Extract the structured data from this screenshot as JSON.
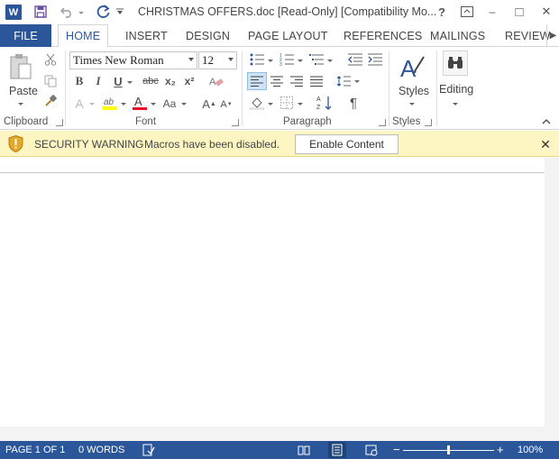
{
  "window": {
    "title": "CHRISTMAS OFFERS.doc [Read-Only] [Compatibility Mo...",
    "logo_letter": "W",
    "help": "?",
    "minimize": "–",
    "restore": "□",
    "close": "✕"
  },
  "tabs": {
    "file": "FILE",
    "items": [
      "HOME",
      "INSERT",
      "DESIGN",
      "PAGE LAYOUT",
      "REFERENCES",
      "MAILINGS",
      "REVIEW"
    ],
    "active": "HOME"
  },
  "ribbon": {
    "clipboard": {
      "label": "Clipboard",
      "paste": "Paste"
    },
    "font": {
      "label": "Font",
      "font_name": "Times New Roman",
      "font_size": "12",
      "bold": "B",
      "italic": "I",
      "underline": "U",
      "strikethrough": "abc",
      "subscript": "x₂",
      "superscript": "x²",
      "change_case": "Aa",
      "grow": "A",
      "shrink": "A",
      "font_color": "A",
      "text_effects": "A"
    },
    "paragraph": {
      "label": "Paragraph",
      "pilcrow": "¶"
    },
    "styles": {
      "label": "Styles",
      "button": "Styles"
    },
    "editing": {
      "button": "Editing"
    }
  },
  "security_bar": {
    "title": "SECURITY WARNING",
    "message": "Macros have been disabled.",
    "button": "Enable Content",
    "close": "✕"
  },
  "status_bar": {
    "page": "PAGE 1 OF 1",
    "words": "0 WORDS",
    "zoom": "100%",
    "zoom_out": "−",
    "zoom_in": "+",
    "zoom_level": 1.0
  },
  "colors": {
    "accent": "#2b579a",
    "security_bar": "#fdf6c3",
    "highlight_yellow": "#ffff00",
    "font_red": "#e81123"
  }
}
